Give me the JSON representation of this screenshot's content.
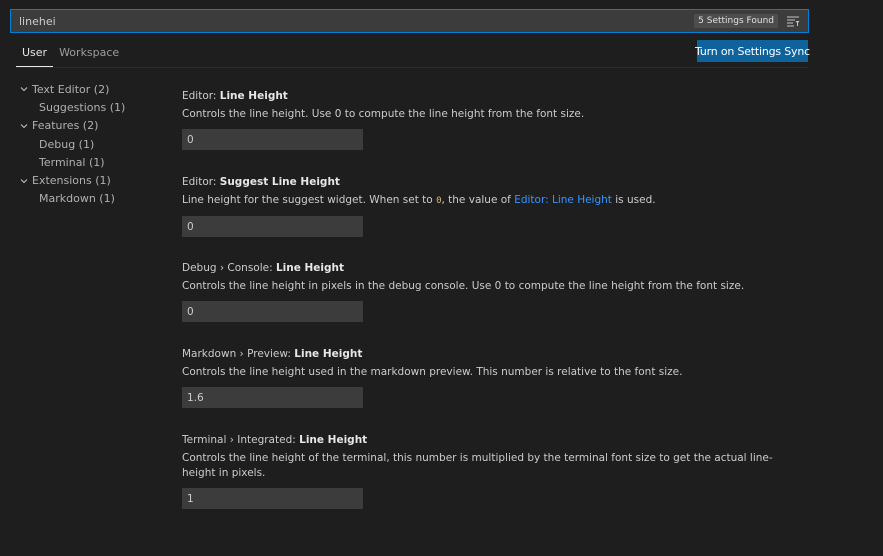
{
  "search": {
    "value": "linehei",
    "results_badge": "5 Settings Found"
  },
  "tabs": [
    {
      "label": "User"
    },
    {
      "label": "Workspace"
    }
  ],
  "sync_button": "Turn on Settings Sync",
  "toc": [
    {
      "label": "Text Editor (2)"
    },
    {
      "label": "Suggestions (1)"
    },
    {
      "label": "Features (2)"
    },
    {
      "label": "Debug (1)"
    },
    {
      "label": "Terminal (1)"
    },
    {
      "label": "Extensions (1)"
    },
    {
      "label": "Markdown (1)"
    }
  ],
  "settings": [
    {
      "category": "Editor: ",
      "key": "Line Height",
      "description": "Controls the line height. Use 0 to compute the line height from the font size.",
      "value": "0"
    },
    {
      "category": "Editor: ",
      "key": "Suggest Line Height",
      "description_pre": "Line height for the suggest widget. When set to ",
      "description_code": "0",
      "description_mid": ", the value of ",
      "description_link": "Editor: Line Height",
      "description_post": " is used.",
      "value": "0"
    },
    {
      "category": "Debug › Console: ",
      "key": "Line Height",
      "description": "Controls the line height in pixels in the debug console. Use 0 to compute the line height from the font size.",
      "value": "0"
    },
    {
      "category": "Markdown › Preview: ",
      "key": "Line Height",
      "description": "Controls the line height used in the markdown preview. This number is relative to the font size.",
      "value": "1.6"
    },
    {
      "category": "Terminal › Integrated: ",
      "key": "Line Height",
      "description": "Controls the line height of the terminal, this number is multiplied by the terminal font size to get the actual line-height in pixels.",
      "value": "1"
    }
  ]
}
